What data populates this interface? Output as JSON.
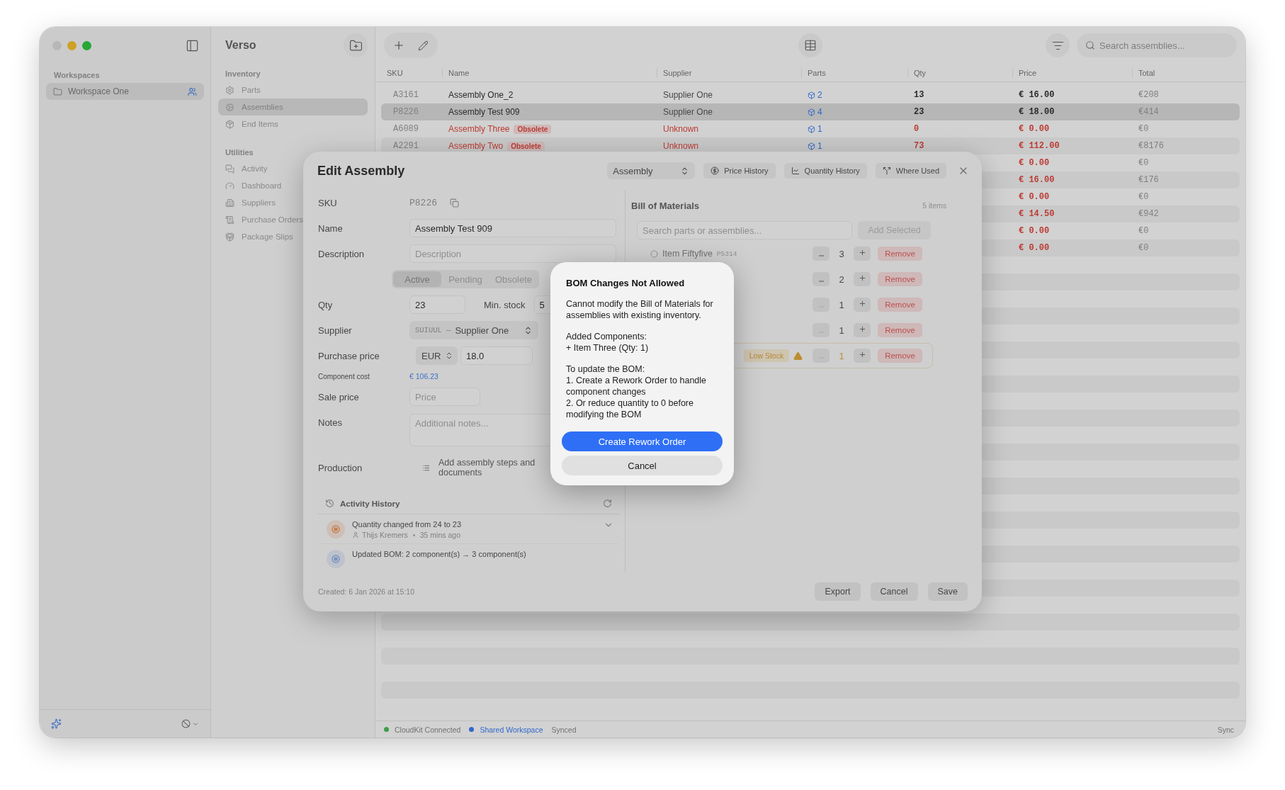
{
  "sidebar": {
    "heading": "Workspaces",
    "workspaces": [
      {
        "label": "Workspace One",
        "selected": true
      }
    ]
  },
  "navigator": {
    "title": "Verso",
    "sections": [
      {
        "heading": "Inventory",
        "items": [
          {
            "label": "Parts",
            "selected": false
          },
          {
            "label": "Assemblies",
            "selected": true
          },
          {
            "label": "End Items",
            "selected": false
          }
        ]
      },
      {
        "heading": "Utilities",
        "items": [
          {
            "label": "Activity",
            "selected": false
          },
          {
            "label": "Dashboard",
            "selected": false
          },
          {
            "label": "Suppliers",
            "selected": false
          },
          {
            "label": "Purchase Orders",
            "selected": false
          },
          {
            "label": "Package Slips",
            "selected": false
          }
        ]
      }
    ]
  },
  "toolbar": {
    "search": {
      "placeholder": "Search assemblies..."
    }
  },
  "table": {
    "columns": [
      "SKU",
      "Name",
      "Supplier",
      "Parts",
      "Qty",
      "Price",
      "Total"
    ],
    "rows": [
      {
        "sku": "A3161",
        "name": "Assembly One_2",
        "supplier": "Supplier One",
        "parts": "2",
        "qty": "13",
        "price": "€ 16.00",
        "total": "€208",
        "selected": false,
        "flagged": false
      },
      {
        "sku": "P8226",
        "name": "Assembly Test 909",
        "supplier": "Supplier One",
        "parts": "4",
        "qty": "23",
        "price": "€ 18.00",
        "total": "€414",
        "selected": true,
        "flagged": false
      },
      {
        "sku": "A6089",
        "name": "Assembly Three",
        "badge": "Obsolete",
        "supplier": "Unknown",
        "parts": "1",
        "qty": "0",
        "price": "€ 0.00",
        "total": "€0",
        "selected": false,
        "flagged": true
      },
      {
        "sku": "A2291",
        "name": "Assembly Two",
        "badge": "Obsolete",
        "supplier": "Unknown",
        "parts": "1",
        "qty": "73",
        "price": "€ 112.00",
        "total": "€8176",
        "selected": false,
        "flagged": true
      },
      {
        "price": "€ 0.00",
        "total": "€0",
        "selected": false,
        "flagged": true
      },
      {
        "price": "€ 16.00",
        "total": "€176",
        "selected": false,
        "flagged": true
      },
      {
        "price": "€ 0.00",
        "total": "€0",
        "selected": false,
        "flagged": true
      },
      {
        "price": "€ 14.50",
        "total": "€942",
        "selected": false,
        "flagged": true
      },
      {
        "price": "€ 0.00",
        "total": "€0",
        "selected": false,
        "flagged": true
      },
      {
        "price": "€ 0.00",
        "total": "€0",
        "selected": false,
        "flagged": true
      }
    ]
  },
  "modal": {
    "title": "Edit Assembly",
    "type_select": "Assembly",
    "actions": [
      "Price History",
      "Quantity History",
      "Where Used"
    ],
    "form": [
      {
        "kind": "readonly",
        "label": "SKU",
        "value": "P8226"
      },
      {
        "kind": "text",
        "label": "Name",
        "value": "Assembly Test 909"
      },
      {
        "kind": "text",
        "label": "Description",
        "placeholder": "Description"
      },
      {
        "kind": "segmented",
        "options": [
          {
            "label": "Active",
            "selected": true
          },
          {
            "label": "Pending",
            "selected": false
          },
          {
            "label": "Obsolete",
            "selected": false
          }
        ]
      },
      {
        "kind": "qty",
        "label": "Qty",
        "value": "23",
        "min_label": "Min. stock",
        "min_value": "5"
      },
      {
        "kind": "select",
        "label": "Supplier",
        "code": "SUIUUL —",
        "value": "Supplier One"
      },
      {
        "kind": "price",
        "label": "Purchase price",
        "currency": "EUR",
        "value": "18.0"
      },
      {
        "kind": "cost",
        "label": "Component cost",
        "value": "€ 106.23"
      },
      {
        "kind": "short",
        "label": "Sale price",
        "placeholder": "Price"
      },
      {
        "kind": "notes",
        "label": "Notes",
        "placeholder": "Additional notes..."
      },
      {
        "kind": "production",
        "label": "Production",
        "value": "Add assembly steps and documents"
      }
    ],
    "activity": {
      "title": "Activity History",
      "entries": [
        {
          "text": "Quantity changed from 24 to 23",
          "user": "Thijs Kremers",
          "time": "35 mins ago",
          "color": "#c88152"
        },
        {
          "text": "Updated BOM: 2 component(s) → 3 component(s)",
          "color": "#7894c3"
        }
      ]
    },
    "bom": {
      "title": "Bill of Materials",
      "count": "5 items",
      "search": {
        "placeholder": "Search parts or assemblies..."
      },
      "add_button": "Add Selected",
      "add_disabled": true,
      "items": [
        {
          "name": "Item Fiftyfive",
          "sku": "P5314",
          "qty": "3",
          "minus_disabled": false,
          "low_stock": false,
          "remove": "Remove"
        },
        {
          "qty": "2",
          "minus_disabled": false,
          "low_stock": false,
          "remove": "Remove"
        },
        {
          "qty": "1",
          "minus_disabled": true,
          "low_stock": false,
          "remove": "Remove"
        },
        {
          "qty": "1",
          "minus_disabled": true,
          "low_stock": false,
          "remove": "Remove"
        },
        {
          "badge": "Low Stock",
          "qty": "1",
          "minus_disabled": true,
          "low_stock": true,
          "remove": "Remove"
        }
      ]
    },
    "created": "Created: 6 Jan 2026 at 15:10",
    "buttons": [
      "Export",
      "Cancel",
      "Save"
    ]
  },
  "alert": {
    "title": "BOM Changes Not Allowed",
    "paragraphs": [
      "Cannot modify the Bill of Materials for assemblies with existing inventory.",
      "Added Components:\n+ Item Three (Qty: 1)",
      "To update the BOM:\n1. Create a Rework Order to handle component changes\n2. Or reduce quantity to 0 before modifying the BOM"
    ],
    "primary": "Create Rework Order",
    "secondary": "Cancel"
  },
  "status_bar": {
    "items": [
      {
        "label": "CloudKit Connected",
        "color": "#409d4d"
      },
      {
        "label": "Shared Workspace",
        "color": "#3268ca"
      },
      {
        "label": "Synced"
      }
    ],
    "right": "Sync"
  }
}
